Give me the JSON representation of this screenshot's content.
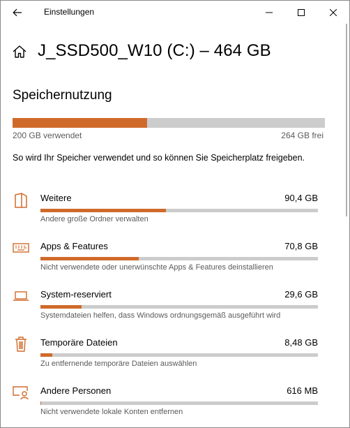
{
  "window": {
    "title": "Einstellungen",
    "accent": "#d06a2b",
    "bar_track": "#cccccc"
  },
  "header": {
    "drive_title": "J_SSD500_W10 (C:) – 464 GB",
    "home_icon": "home-icon"
  },
  "usage": {
    "section_title": "Speichernutzung",
    "used_label": "200 GB verwendet",
    "free_label": "264 GB frei",
    "used_fraction": 0.431,
    "description": "So wird Ihr Speicher verwendet und so können Sie Speicherplatz freigeben."
  },
  "categories": [
    {
      "name": "Weitere",
      "size": "90,4 GB",
      "description": "Andere große Ordner verwalten",
      "fraction": 0.452,
      "icon": "folder-icon"
    },
    {
      "name": "Apps & Features",
      "size": "70,8 GB",
      "description": "Nicht verwendete oder unerwünschte Apps & Features deinstallieren",
      "fraction": 0.354,
      "icon": "keyboard-icon"
    },
    {
      "name": "System-reserviert",
      "size": "29,6 GB",
      "description": "Systemdateien helfen, dass Windows ordnungsgemäß ausgeführt wird",
      "fraction": 0.148,
      "icon": "laptop-icon"
    },
    {
      "name": "Temporäre Dateien",
      "size": "8,48 GB",
      "description": "Zu entfernende temporäre Dateien auswählen",
      "fraction": 0.042,
      "icon": "trash-icon"
    },
    {
      "name": "Andere Personen",
      "size": "616 MB",
      "description": "Nicht verwendete lokale Konten entfernen",
      "fraction": 0.003,
      "icon": "user-account-icon"
    }
  ]
}
